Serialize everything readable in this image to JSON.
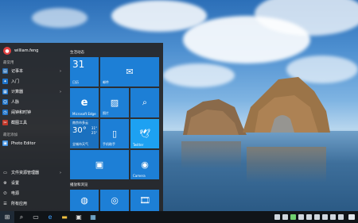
{
  "user": {
    "name": "william.feng"
  },
  "sections": {
    "most_used": "最常用",
    "recent": "最近添加",
    "life": "生活动态",
    "play": "播放和浏览"
  },
  "menu_items": [
    {
      "label": "记事本",
      "icon": "notepad-icon",
      "color": "#2a6db0",
      "has_arrow": true
    },
    {
      "label": "入门",
      "icon": "lightbulb-icon",
      "color": "#1e73c8",
      "has_arrow": false
    },
    {
      "label": "计算器",
      "icon": "calculator-icon",
      "color": "#1e73c8",
      "has_arrow": true
    },
    {
      "label": "人脉",
      "icon": "people-icon",
      "color": "#1e73c8",
      "has_arrow": false
    },
    {
      "label": "闹钟和时钟",
      "icon": "alarm-icon",
      "color": "#1e73c8",
      "has_arrow": false
    },
    {
      "label": "截图工具",
      "icon": "scissors-icon",
      "color": "#c0392b",
      "has_arrow": false
    }
  ],
  "recent_items": [
    {
      "label": "Photo Editor",
      "icon": "photo-editor-icon",
      "color": "#3a8de0"
    }
  ],
  "bottom_items": [
    {
      "label": "文件资源管理器",
      "icon": "folder-icon",
      "has_arrow": true
    },
    {
      "label": "设置",
      "icon": "gear-icon",
      "has_arrow": false
    },
    {
      "label": "电源",
      "icon": "power-icon",
      "has_arrow": false
    },
    {
      "label": "所有应用",
      "icon": "apps-icon",
      "has_arrow": false
    }
  ],
  "tiles": {
    "calendar": {
      "day": "31",
      "label": "日历"
    },
    "mail": {
      "label": "邮件"
    },
    "edge": {
      "label": "Microsoft Edge"
    },
    "photos": {
      "label": "照片"
    },
    "search": {
      "label": ""
    },
    "weather": {
      "city": "南京市多云",
      "temp": "30°",
      "hi": "31°",
      "lo": "25°",
      "label": "全城市天气"
    },
    "phone": {
      "label": "手机助手"
    },
    "twitter": {
      "label": "Twitter"
    },
    "store": {
      "label": ""
    },
    "camera": {
      "label": "Camera"
    }
  },
  "taskbar": {
    "time": "",
    "date": ""
  },
  "colors": {
    "tile_blue": "#1d7fd6",
    "twitter_blue": "#1da1f2",
    "menu_bg": "#262628"
  }
}
